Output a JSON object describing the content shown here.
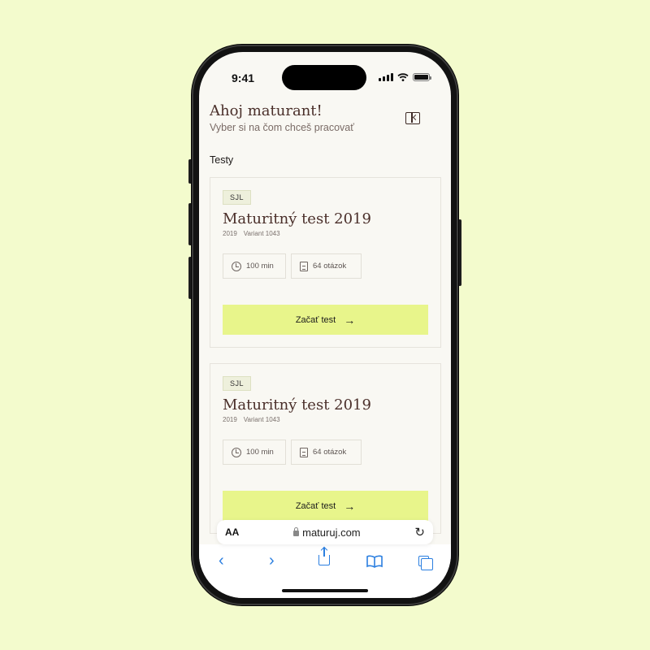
{
  "status_bar": {
    "time": "9:41"
  },
  "header": {
    "greeting": "Ahoj maturant!",
    "subtitle": "Vyber si na čom chceš pracovať"
  },
  "section": {
    "title": "Testy"
  },
  "tests": [
    {
      "tag": "SJL",
      "title": "Maturitný test 2019",
      "year": "2019",
      "variant": "Variant 1043",
      "duration": "100 min",
      "questions": "64 otázok",
      "cta": "Začať test"
    },
    {
      "tag": "SJL",
      "title": "Maturitný test 2019",
      "year": "2019",
      "variant": "Variant 1043",
      "duration": "100 min",
      "questions": "64 otázok",
      "cta": "Začať test"
    }
  ],
  "browser": {
    "text_size_label": "AA",
    "url": "maturuj.com",
    "icons": [
      "back-icon",
      "forward-icon",
      "share-icon",
      "bookmarks-icon",
      "tabs-icon",
      "reload-icon",
      "lock-icon"
    ]
  },
  "colors": {
    "background": "#f3fbcd",
    "screen": "#f9f8f3",
    "heading": "#4a2f2a",
    "cta": "#e8f58b",
    "link_blue": "#2b7fe0"
  }
}
